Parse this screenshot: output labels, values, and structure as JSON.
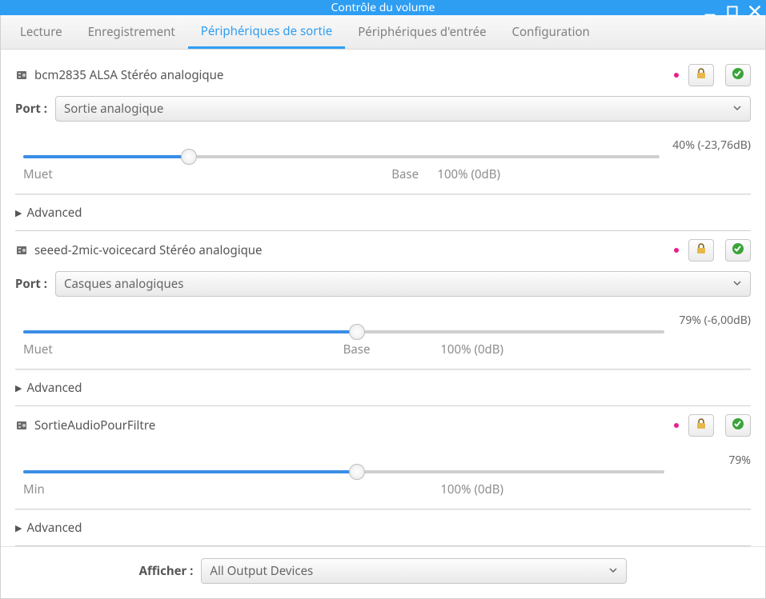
{
  "window": {
    "title": "Contrôle du volume"
  },
  "tabs": {
    "lecture": "Lecture",
    "enregistrement": "Enregistrement",
    "sortie": "Périphériques de sortie",
    "entree": "Périphériques d'entrée",
    "config": "Configuration"
  },
  "labels": {
    "port": "Port :",
    "advanced": "Advanced",
    "afficher": "Afficher :"
  },
  "scale": {
    "muet": "Muet",
    "min": "Min",
    "base": "Base",
    "hundred": "100% (0dB)"
  },
  "devices": [
    {
      "name": "bcm2835 ALSA Stéréo analogique",
      "port": "Sortie analogique",
      "has_port": true,
      "percent": 40,
      "readout": "40% (-23,76dB)",
      "slider": {
        "fill_pct": 26,
        "base_pct": 60,
        "hundred_pct": 70,
        "left_label": "muet"
      }
    },
    {
      "name": "seeed-2mic-voicecard Stéréo analogique",
      "port": "Casques analogiques",
      "has_port": true,
      "percent": 79,
      "readout": "79% (-6,00dB)",
      "slider": {
        "fill_pct": 52,
        "base_pct": 52,
        "hundred_pct": 70,
        "left_label": "muet"
      }
    },
    {
      "name": "SortieAudioPourFiltre",
      "has_port": false,
      "percent": 79,
      "readout": "79%",
      "slider": {
        "fill_pct": 52,
        "base_pct": 52,
        "hundred_pct": 70,
        "left_label": "min"
      }
    }
  ],
  "filter": {
    "value": "All Output Devices"
  }
}
